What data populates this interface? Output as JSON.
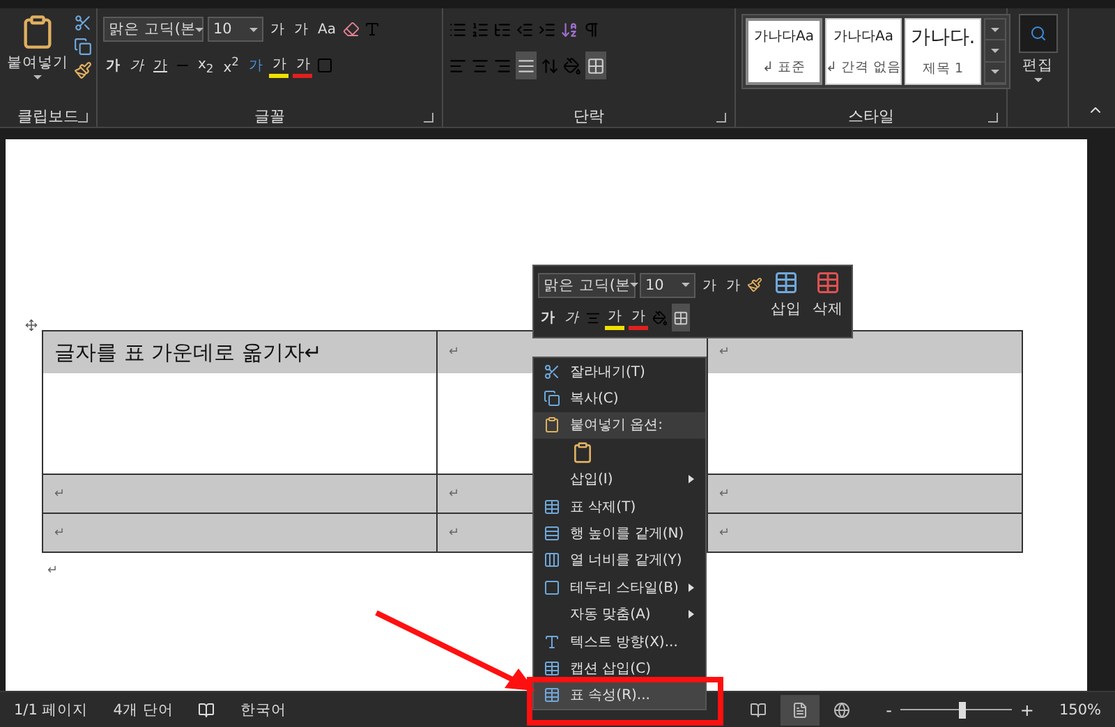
{
  "ribbon": {
    "clipboard": {
      "paste_label": "붙여넣기",
      "label": "클립보드"
    },
    "font": {
      "font_name": "맑은 고딕(본",
      "font_size": "10",
      "grow": "가",
      "shrink": "가",
      "case": "Aa",
      "bold": "가",
      "italic": "가",
      "underline": "가",
      "subscript": "x$_{2}$",
      "superscript": "x$^{2}$",
      "effects": "가",
      "highlight": "가",
      "font_color": "가",
      "label": "글꼴"
    },
    "paragraph": {
      "label": "단락"
    },
    "styles": {
      "label": "스타일",
      "items": [
        {
          "sample": "가나다Aa",
          "name": "↲ 표준",
          "selected": true
        },
        {
          "sample": "가나다Aa",
          "name": "↲ 간격 없음",
          "selected": false
        },
        {
          "sample": "가나다.",
          "name": "제목 1",
          "selected": false
        }
      ]
    },
    "editing": {
      "label": "편집"
    }
  },
  "table": {
    "rows": [
      {
        "selected": true,
        "cells": [
          "글자를 표 가운데로 옮기자↵",
          "↵",
          "↵"
        ]
      },
      {
        "selected": true,
        "cells": [
          "↵",
          "↵",
          "↵"
        ]
      },
      {
        "selected": true,
        "cells": [
          "↵",
          "↵",
          "↵"
        ]
      }
    ],
    "after_mark": "↵"
  },
  "mini_toolbar": {
    "font_name": "맑은 고딕(본",
    "font_size": "10",
    "grow": "가",
    "shrink": "가",
    "bold": "가",
    "italic": "가",
    "highlight": "가",
    "font_color": "가",
    "insert": "삽입",
    "delete": "삭제"
  },
  "context_menu": {
    "items": [
      {
        "kind": "item",
        "label": "잘라내기(T)",
        "submenu": false,
        "selected": false
      },
      {
        "kind": "item",
        "label": "복사(C)",
        "submenu": false,
        "selected": false
      },
      {
        "kind": "header",
        "label": "붙여넣기 옵션:"
      },
      {
        "kind": "paste"
      },
      {
        "kind": "item",
        "label": "삽입(I)",
        "submenu": true,
        "selected": false
      },
      {
        "kind": "item",
        "label": "표 삭제(T)",
        "submenu": false,
        "selected": false
      },
      {
        "kind": "item",
        "label": "행 높이를 같게(N)",
        "submenu": false,
        "selected": false
      },
      {
        "kind": "item",
        "label": "열 너비를 같게(Y)",
        "submenu": false,
        "selected": false
      },
      {
        "kind": "item",
        "label": "테두리 스타일(B)",
        "submenu": true,
        "selected": false
      },
      {
        "kind": "item",
        "label": "자동 맞춤(A)",
        "submenu": true,
        "selected": false
      },
      {
        "kind": "item",
        "label": "텍스트 방향(X)...",
        "submenu": false,
        "selected": false
      },
      {
        "kind": "item",
        "label": "캡션 삽입(C)",
        "submenu": false,
        "selected": false
      },
      {
        "kind": "item",
        "label": "표 속성(R)...",
        "submenu": false,
        "selected": true
      }
    ]
  },
  "status_bar": {
    "page": "1/1 페이지",
    "words": "4개 단어",
    "language": "한국어",
    "views": [
      {
        "kind": "read",
        "selected": false
      },
      {
        "kind": "print",
        "selected": true
      },
      {
        "kind": "web",
        "selected": false
      }
    ],
    "zoom_minus": "-",
    "zoom_plus": "+",
    "zoom": {
      "level": 0.55
    },
    "zoom_text": "150%"
  }
}
